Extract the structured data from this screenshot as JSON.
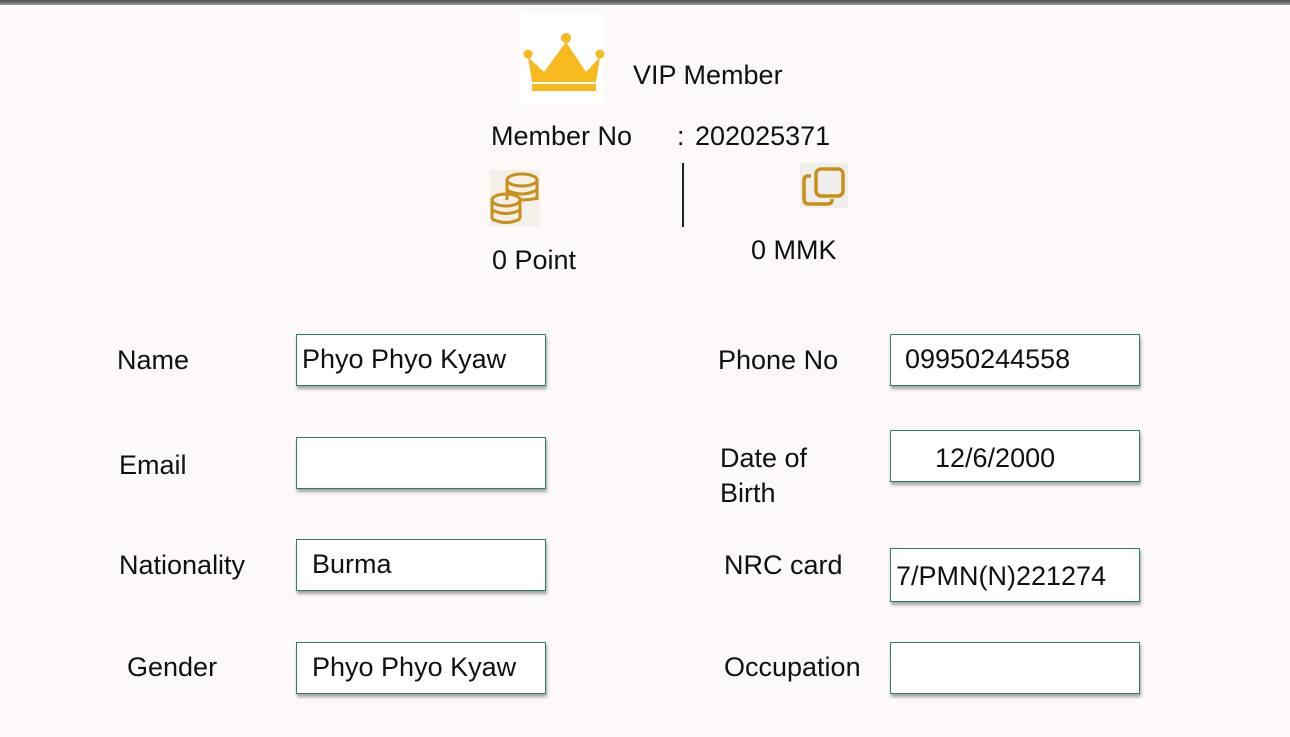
{
  "header": {
    "title": "VIP Member",
    "member_no_label": "Member No",
    "member_no_sep": ":",
    "member_no_value": "202025371",
    "points": "0 Point",
    "balance": "0 MMK"
  },
  "colors": {
    "crown": "#f6b91e",
    "icon_gold": "#c8901a",
    "field_border": "#2e7d6b"
  },
  "icons": {
    "crown": "crown-icon",
    "points": "coins-icon",
    "balance": "copy-icon"
  },
  "form": {
    "name_label": "Name",
    "name_value": "Phyo Phyo Kyaw",
    "email_label": "Email",
    "email_value": "",
    "nationality_label": "Nationality",
    "nationality_value": "Burma",
    "gender_label": "Gender",
    "gender_value": "Phyo Phyo Kyaw",
    "phone_label": "Phone No",
    "phone_value": "09950244558",
    "dob_label_line1": "Date of",
    "dob_label_line2": "Birth",
    "dob_value": "12/6/2000",
    "nrc_label": "NRC card",
    "nrc_value": "7/PMN(N)221274",
    "occupation_label": "Occupation",
    "occupation_value": ""
  }
}
